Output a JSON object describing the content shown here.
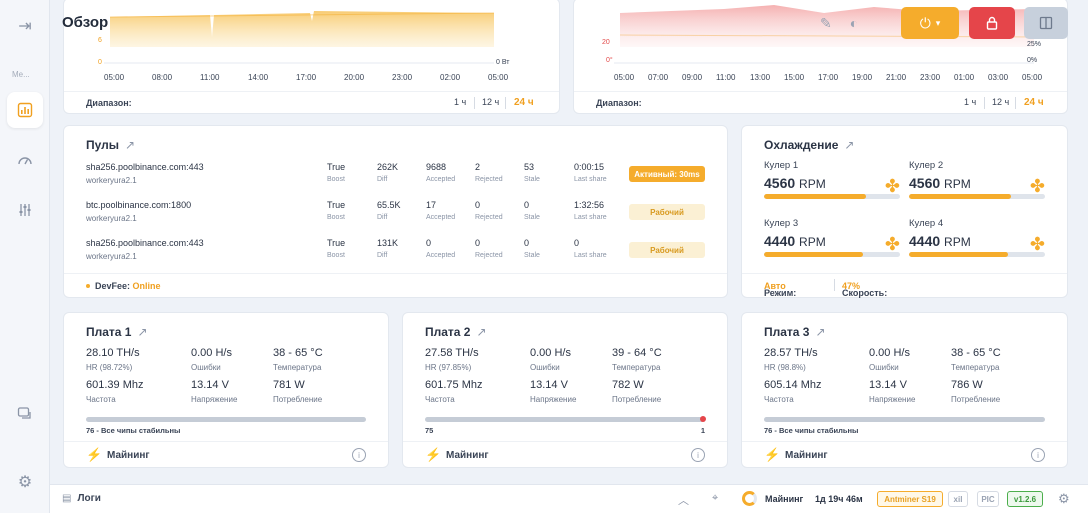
{
  "header": {
    "title": "Обзор"
  },
  "sidebar": {
    "menu_label": "Me..."
  },
  "charts": {
    "hashrate": {
      "x_ticks": [
        "05:00",
        "08:00",
        "11:00",
        "14:00",
        "17:00",
        "20:00",
        "23:00",
        "02:00",
        "05:00"
      ],
      "y_ticks_left": [
        "6",
        "0"
      ],
      "y_ticks_right": [
        "0 Вт"
      ],
      "range_label": "Диапазон:",
      "ranges": [
        "1 ч",
        "12 ч",
        "24 ч"
      ],
      "active_range": "24 ч"
    },
    "temperature": {
      "x_ticks": [
        "05:00",
        "07:00",
        "09:00",
        "11:00",
        "13:00",
        "15:00",
        "17:00",
        "19:00",
        "21:00",
        "23:00",
        "01:00",
        "03:00",
        "05:00"
      ],
      "y_ticks_left": [
        "20",
        "0°"
      ],
      "y_ticks_right": [
        "25%",
        "0%"
      ],
      "range_label": "Диапазон:",
      "ranges": [
        "1 ч",
        "12 ч",
        "24 ч"
      ],
      "active_range": "24 ч"
    }
  },
  "pools": {
    "title": "Пулы",
    "labels": {
      "boost": "Boost",
      "diff": "Diff",
      "accepted": "Accepted",
      "rejected": "Rejected",
      "stale": "Stale",
      "last_share": "Last share"
    },
    "rows": [
      {
        "url": "sha256.poolbinance.com:443",
        "worker": "workeryura2.1",
        "boost": "True",
        "diff": "262K",
        "accepted": "9688",
        "rejected": "2",
        "stale": "53",
        "last_share": "0:00:15",
        "status": "Активный: 30ms"
      },
      {
        "url": "btc.poolbinance.com:1800",
        "worker": "workeryura2.1",
        "boost": "True",
        "diff": "65.5K",
        "accepted": "17",
        "rejected": "0",
        "stale": "0",
        "last_share": "1:32:56",
        "status": "Рабочий"
      },
      {
        "url": "sha256.poolbinance.com:443",
        "worker": "workeryura2.1",
        "boost": "True",
        "diff": "131K",
        "accepted": "0",
        "rejected": "0",
        "stale": "0",
        "last_share": "0",
        "status": "Рабочий"
      }
    ],
    "devfee_label": "DevFee:",
    "devfee_value": "Online"
  },
  "cooling": {
    "title": "Охлаждение",
    "unit": "RPM",
    "fans": [
      {
        "name": "Кулер 1",
        "rpm": "4560",
        "level": 0.75
      },
      {
        "name": "Кулер 2",
        "rpm": "4560",
        "level": 0.75
      },
      {
        "name": "Кулер 3",
        "rpm": "4440",
        "level": 0.73
      },
      {
        "name": "Кулер 4",
        "rpm": "4440",
        "level": 0.73
      }
    ],
    "mode_label": "Режим:",
    "mode_value": "Авто",
    "speed_label": "Скорость:",
    "speed_value": "47%"
  },
  "boards": [
    {
      "title": "Плата 1",
      "hashrate": "28.10 TH/s",
      "hr_label": "HR (98.72%)",
      "errors": "0.00 H/s",
      "errors_label": "Ошибки",
      "temp": "38 - 65 °C",
      "temp_label": "Температура",
      "freq": "601.39 Mhz",
      "freq_label": "Частота",
      "voltage": "13.14 V",
      "voltage_label": "Напряжение",
      "power": "781 W",
      "power_label": "Потребление",
      "chips": "76 - Все чипы стабильны",
      "chips_right": "",
      "footer": "Майнинг"
    },
    {
      "title": "Плата 2",
      "hashrate": "27.58 TH/s",
      "hr_label": "HR (97.85%)",
      "errors": "0.00 H/s",
      "errors_label": "Ошибки",
      "temp": "39 - 64 °C",
      "temp_label": "Температура",
      "freq": "601.75 Mhz",
      "freq_label": "Частота",
      "voltage": "13.14 V",
      "voltage_label": "Напряжение",
      "power": "782 W",
      "power_label": "Потребление",
      "chips": "75",
      "chips_right": "1",
      "footer": "Майнинг"
    },
    {
      "title": "Плата 3",
      "hashrate": "28.57 TH/s",
      "hr_label": "HR (98.8%)",
      "errors": "0.00 H/s",
      "errors_label": "Ошибки",
      "temp": "38 - 65 °C",
      "temp_label": "Температура",
      "freq": "605.14 Mhz",
      "freq_label": "Частота",
      "voltage": "13.14 V",
      "voltage_label": "Напряжение",
      "power": "786 W",
      "power_label": "Потребление",
      "chips": "76 - Все чипы стабильны",
      "chips_right": "",
      "footer": "Майнинг"
    }
  ],
  "bottombar": {
    "logs": "Логи",
    "status": "Майнинг",
    "uptime": "1д 19ч 46м",
    "model": "Antminer S19",
    "xil": "xil",
    "pic": "PIC",
    "version": "v1.2.6"
  },
  "colors": {
    "accent": "#f5ac2c",
    "danger": "#e5454a",
    "ok": "#4cae4c"
  }
}
